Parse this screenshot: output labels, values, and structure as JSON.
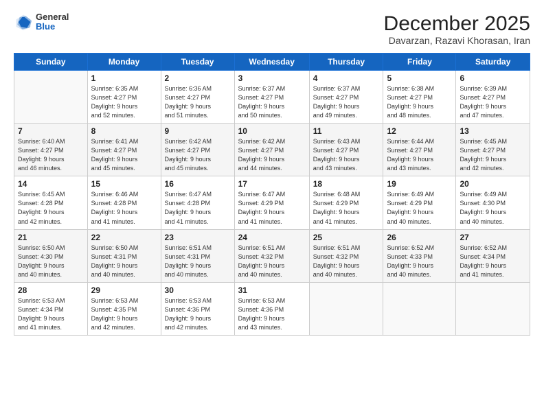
{
  "header": {
    "logo_general": "General",
    "logo_blue": "Blue",
    "title": "December 2025",
    "subtitle": "Davarzan, Razavi Khorasan, Iran"
  },
  "days_of_week": [
    "Sunday",
    "Monday",
    "Tuesday",
    "Wednesday",
    "Thursday",
    "Friday",
    "Saturday"
  ],
  "weeks": [
    [
      {
        "day": "",
        "info": ""
      },
      {
        "day": "1",
        "info": "Sunrise: 6:35 AM\nSunset: 4:27 PM\nDaylight: 9 hours\nand 52 minutes."
      },
      {
        "day": "2",
        "info": "Sunrise: 6:36 AM\nSunset: 4:27 PM\nDaylight: 9 hours\nand 51 minutes."
      },
      {
        "day": "3",
        "info": "Sunrise: 6:37 AM\nSunset: 4:27 PM\nDaylight: 9 hours\nand 50 minutes."
      },
      {
        "day": "4",
        "info": "Sunrise: 6:37 AM\nSunset: 4:27 PM\nDaylight: 9 hours\nand 49 minutes."
      },
      {
        "day": "5",
        "info": "Sunrise: 6:38 AM\nSunset: 4:27 PM\nDaylight: 9 hours\nand 48 minutes."
      },
      {
        "day": "6",
        "info": "Sunrise: 6:39 AM\nSunset: 4:27 PM\nDaylight: 9 hours\nand 47 minutes."
      }
    ],
    [
      {
        "day": "7",
        "info": "Sunrise: 6:40 AM\nSunset: 4:27 PM\nDaylight: 9 hours\nand 46 minutes."
      },
      {
        "day": "8",
        "info": "Sunrise: 6:41 AM\nSunset: 4:27 PM\nDaylight: 9 hours\nand 45 minutes."
      },
      {
        "day": "9",
        "info": "Sunrise: 6:42 AM\nSunset: 4:27 PM\nDaylight: 9 hours\nand 45 minutes."
      },
      {
        "day": "10",
        "info": "Sunrise: 6:42 AM\nSunset: 4:27 PM\nDaylight: 9 hours\nand 44 minutes."
      },
      {
        "day": "11",
        "info": "Sunrise: 6:43 AM\nSunset: 4:27 PM\nDaylight: 9 hours\nand 43 minutes."
      },
      {
        "day": "12",
        "info": "Sunrise: 6:44 AM\nSunset: 4:27 PM\nDaylight: 9 hours\nand 43 minutes."
      },
      {
        "day": "13",
        "info": "Sunrise: 6:45 AM\nSunset: 4:27 PM\nDaylight: 9 hours\nand 42 minutes."
      }
    ],
    [
      {
        "day": "14",
        "info": "Sunrise: 6:45 AM\nSunset: 4:28 PM\nDaylight: 9 hours\nand 42 minutes."
      },
      {
        "day": "15",
        "info": "Sunrise: 6:46 AM\nSunset: 4:28 PM\nDaylight: 9 hours\nand 41 minutes."
      },
      {
        "day": "16",
        "info": "Sunrise: 6:47 AM\nSunset: 4:28 PM\nDaylight: 9 hours\nand 41 minutes."
      },
      {
        "day": "17",
        "info": "Sunrise: 6:47 AM\nSunset: 4:29 PM\nDaylight: 9 hours\nand 41 minutes."
      },
      {
        "day": "18",
        "info": "Sunrise: 6:48 AM\nSunset: 4:29 PM\nDaylight: 9 hours\nand 41 minutes."
      },
      {
        "day": "19",
        "info": "Sunrise: 6:49 AM\nSunset: 4:29 PM\nDaylight: 9 hours\nand 40 minutes."
      },
      {
        "day": "20",
        "info": "Sunrise: 6:49 AM\nSunset: 4:30 PM\nDaylight: 9 hours\nand 40 minutes."
      }
    ],
    [
      {
        "day": "21",
        "info": "Sunrise: 6:50 AM\nSunset: 4:30 PM\nDaylight: 9 hours\nand 40 minutes."
      },
      {
        "day": "22",
        "info": "Sunrise: 6:50 AM\nSunset: 4:31 PM\nDaylight: 9 hours\nand 40 minutes."
      },
      {
        "day": "23",
        "info": "Sunrise: 6:51 AM\nSunset: 4:31 PM\nDaylight: 9 hours\nand 40 minutes."
      },
      {
        "day": "24",
        "info": "Sunrise: 6:51 AM\nSunset: 4:32 PM\nDaylight: 9 hours\nand 40 minutes."
      },
      {
        "day": "25",
        "info": "Sunrise: 6:51 AM\nSunset: 4:32 PM\nDaylight: 9 hours\nand 40 minutes."
      },
      {
        "day": "26",
        "info": "Sunrise: 6:52 AM\nSunset: 4:33 PM\nDaylight: 9 hours\nand 40 minutes."
      },
      {
        "day": "27",
        "info": "Sunrise: 6:52 AM\nSunset: 4:34 PM\nDaylight: 9 hours\nand 41 minutes."
      }
    ],
    [
      {
        "day": "28",
        "info": "Sunrise: 6:53 AM\nSunset: 4:34 PM\nDaylight: 9 hours\nand 41 minutes."
      },
      {
        "day": "29",
        "info": "Sunrise: 6:53 AM\nSunset: 4:35 PM\nDaylight: 9 hours\nand 42 minutes."
      },
      {
        "day": "30",
        "info": "Sunrise: 6:53 AM\nSunset: 4:36 PM\nDaylight: 9 hours\nand 42 minutes."
      },
      {
        "day": "31",
        "info": "Sunrise: 6:53 AM\nSunset: 4:36 PM\nDaylight: 9 hours\nand 43 minutes."
      },
      {
        "day": "",
        "info": ""
      },
      {
        "day": "",
        "info": ""
      },
      {
        "day": "",
        "info": ""
      }
    ]
  ]
}
